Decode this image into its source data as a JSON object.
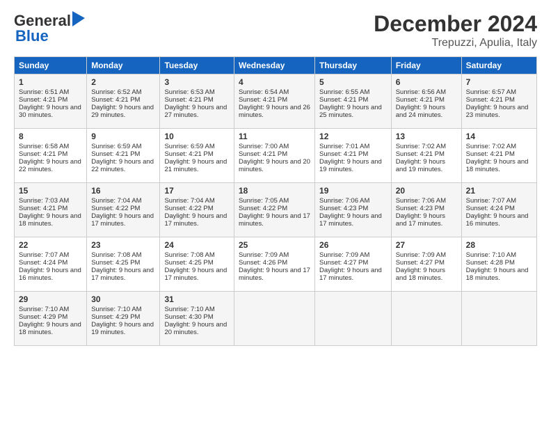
{
  "logo": {
    "line1": "General",
    "line2": "Blue"
  },
  "title": "December 2024",
  "subtitle": "Trepuzzi, Apulia, Italy",
  "days": [
    "Sunday",
    "Monday",
    "Tuesday",
    "Wednesday",
    "Thursday",
    "Friday",
    "Saturday"
  ],
  "weeks": [
    [
      {
        "day": 1,
        "sunrise": "6:51 AM",
        "sunset": "4:21 PM",
        "daylight": "9 hours and 30 minutes."
      },
      {
        "day": 2,
        "sunrise": "6:52 AM",
        "sunset": "4:21 PM",
        "daylight": "9 hours and 29 minutes."
      },
      {
        "day": 3,
        "sunrise": "6:53 AM",
        "sunset": "4:21 PM",
        "daylight": "9 hours and 27 minutes."
      },
      {
        "day": 4,
        "sunrise": "6:54 AM",
        "sunset": "4:21 PM",
        "daylight": "9 hours and 26 minutes."
      },
      {
        "day": 5,
        "sunrise": "6:55 AM",
        "sunset": "4:21 PM",
        "daylight": "9 hours and 25 minutes."
      },
      {
        "day": 6,
        "sunrise": "6:56 AM",
        "sunset": "4:21 PM",
        "daylight": "9 hours and 24 minutes."
      },
      {
        "day": 7,
        "sunrise": "6:57 AM",
        "sunset": "4:21 PM",
        "daylight": "9 hours and 23 minutes."
      }
    ],
    [
      {
        "day": 8,
        "sunrise": "6:58 AM",
        "sunset": "4:21 PM",
        "daylight": "9 hours and 22 minutes."
      },
      {
        "day": 9,
        "sunrise": "6:59 AM",
        "sunset": "4:21 PM",
        "daylight": "9 hours and 22 minutes."
      },
      {
        "day": 10,
        "sunrise": "6:59 AM",
        "sunset": "4:21 PM",
        "daylight": "9 hours and 21 minutes."
      },
      {
        "day": 11,
        "sunrise": "7:00 AM",
        "sunset": "4:21 PM",
        "daylight": "9 hours and 20 minutes."
      },
      {
        "day": 12,
        "sunrise": "7:01 AM",
        "sunset": "4:21 PM",
        "daylight": "9 hours and 19 minutes."
      },
      {
        "day": 13,
        "sunrise": "7:02 AM",
        "sunset": "4:21 PM",
        "daylight": "9 hours and 19 minutes."
      },
      {
        "day": 14,
        "sunrise": "7:02 AM",
        "sunset": "4:21 PM",
        "daylight": "9 hours and 18 minutes."
      }
    ],
    [
      {
        "day": 15,
        "sunrise": "7:03 AM",
        "sunset": "4:21 PM",
        "daylight": "9 hours and 18 minutes."
      },
      {
        "day": 16,
        "sunrise": "7:04 AM",
        "sunset": "4:22 PM",
        "daylight": "9 hours and 17 minutes."
      },
      {
        "day": 17,
        "sunrise": "7:04 AM",
        "sunset": "4:22 PM",
        "daylight": "9 hours and 17 minutes."
      },
      {
        "day": 18,
        "sunrise": "7:05 AM",
        "sunset": "4:22 PM",
        "daylight": "9 hours and 17 minutes."
      },
      {
        "day": 19,
        "sunrise": "7:06 AM",
        "sunset": "4:23 PM",
        "daylight": "9 hours and 17 minutes."
      },
      {
        "day": 20,
        "sunrise": "7:06 AM",
        "sunset": "4:23 PM",
        "daylight": "9 hours and 17 minutes."
      },
      {
        "day": 21,
        "sunrise": "7:07 AM",
        "sunset": "4:24 PM",
        "daylight": "9 hours and 16 minutes."
      }
    ],
    [
      {
        "day": 22,
        "sunrise": "7:07 AM",
        "sunset": "4:24 PM",
        "daylight": "9 hours and 16 minutes."
      },
      {
        "day": 23,
        "sunrise": "7:08 AM",
        "sunset": "4:25 PM",
        "daylight": "9 hours and 17 minutes."
      },
      {
        "day": 24,
        "sunrise": "7:08 AM",
        "sunset": "4:25 PM",
        "daylight": "9 hours and 17 minutes."
      },
      {
        "day": 25,
        "sunrise": "7:09 AM",
        "sunset": "4:26 PM",
        "daylight": "9 hours and 17 minutes."
      },
      {
        "day": 26,
        "sunrise": "7:09 AM",
        "sunset": "4:27 PM",
        "daylight": "9 hours and 17 minutes."
      },
      {
        "day": 27,
        "sunrise": "7:09 AM",
        "sunset": "4:27 PM",
        "daylight": "9 hours and 18 minutes."
      },
      {
        "day": 28,
        "sunrise": "7:10 AM",
        "sunset": "4:28 PM",
        "daylight": "9 hours and 18 minutes."
      }
    ],
    [
      {
        "day": 29,
        "sunrise": "7:10 AM",
        "sunset": "4:29 PM",
        "daylight": "9 hours and 18 minutes."
      },
      {
        "day": 30,
        "sunrise": "7:10 AM",
        "sunset": "4:29 PM",
        "daylight": "9 hours and 19 minutes."
      },
      {
        "day": 31,
        "sunrise": "7:10 AM",
        "sunset": "4:30 PM",
        "daylight": "9 hours and 20 minutes."
      },
      null,
      null,
      null,
      null
    ]
  ]
}
